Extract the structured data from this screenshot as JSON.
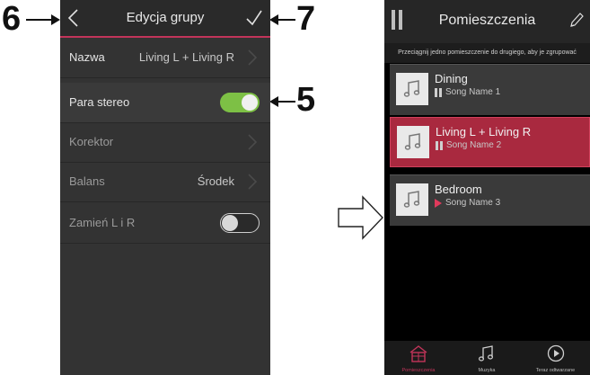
{
  "callouts": {
    "six": "6",
    "seven": "7",
    "five": "5"
  },
  "group_edit": {
    "title": "Edycja grupy",
    "rows": [
      {
        "label": "Nazwa",
        "value": "Living L + Living R"
      },
      {
        "label": "Para stereo",
        "toggle": "on"
      },
      {
        "label": "Korektor"
      },
      {
        "label": "Balans",
        "value": "Środek"
      },
      {
        "label": "Zamień L i R",
        "toggle": "off"
      }
    ]
  },
  "rooms_screen": {
    "title": "Pomieszczenia",
    "hint": "Przeciągnij jedno pomieszczenie do drugiego, aby je zgrupować",
    "rooms": [
      {
        "name": "Dining",
        "song": "Song Name 1",
        "state": "paused"
      },
      {
        "name": "Living L + Living R",
        "song": "Song Name 2",
        "state": "paused"
      },
      {
        "name": "Bedroom",
        "song": "Song Name 3",
        "state": "playing"
      }
    ],
    "tabs": [
      {
        "label": "Pomieszczenia",
        "icon": "house-icon"
      },
      {
        "label": "Muzyka",
        "icon": "music-note-icon"
      },
      {
        "label": "Teraz odtwarzane",
        "icon": "play-circle-icon"
      }
    ]
  },
  "colors": {
    "accent": "#c2345a",
    "toggle_on": "#7dc045",
    "active_room": "#a9293f"
  }
}
